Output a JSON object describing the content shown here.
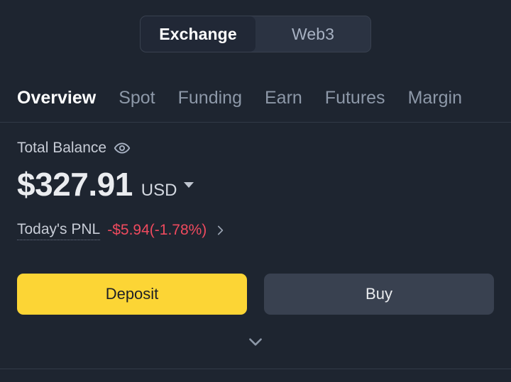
{
  "app": {
    "background_color": "#1e2530",
    "accent_color": "#fcd535",
    "negative_color": "#ef4a5e"
  },
  "segmented_toggle": {
    "options": [
      {
        "label": "Exchange",
        "active": true
      },
      {
        "label": "Web3",
        "active": false
      }
    ]
  },
  "tabs": [
    {
      "label": "Overview",
      "active": true
    },
    {
      "label": "Spot",
      "active": false
    },
    {
      "label": "Funding",
      "active": false
    },
    {
      "label": "Earn",
      "active": false
    },
    {
      "label": "Futures",
      "active": false
    },
    {
      "label": "Margin",
      "active": false
    }
  ],
  "balance": {
    "label": "Total Balance",
    "visibility_icon": "eye-icon",
    "amount": "$327.91",
    "currency": "USD",
    "currency_caret_icon": "caret-down-icon"
  },
  "pnl": {
    "label": "Today's PNL",
    "value": "-$5.94(-1.78%)",
    "chevron_icon": "chevron-right-icon"
  },
  "actions": {
    "deposit_label": "Deposit",
    "buy_label": "Buy"
  },
  "expand": {
    "icon": "chevron-down-icon"
  }
}
